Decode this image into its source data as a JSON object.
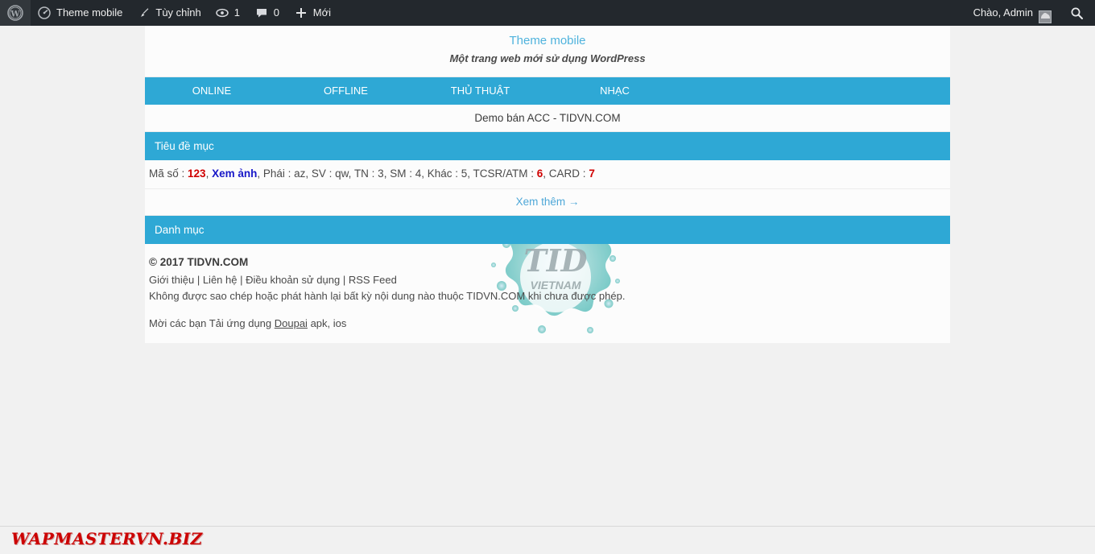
{
  "adminbar": {
    "wp_logo_icon": "wordpress-logo-icon",
    "site_icon": "dashboard-speedometer-icon",
    "site_name": "Theme mobile",
    "customize_icon": "paintbrush-icon",
    "customize_label": "Tùy chỉnh",
    "updates_icon": "updates-refresh-icon",
    "updates_count": "1",
    "comments_icon": "comment-bubble-icon",
    "comments_count": "0",
    "new_icon": "plus-icon",
    "new_label": "Mới",
    "howdy": "Chào, Admin",
    "avatar_icon": "user-avatar-icon",
    "search_icon": "search-icon"
  },
  "header": {
    "site_title": "Theme mobile",
    "tagline": "Một trang web mới sử dụng WordPress"
  },
  "nav": {
    "items": [
      {
        "label": "ONLINE"
      },
      {
        "label": "OFFLINE"
      },
      {
        "label": "THỦ THUẬT"
      },
      {
        "label": "NHẠC"
      }
    ]
  },
  "main": {
    "banner": "Demo bán ACC - TIDVN.COM",
    "section_title": "Tiêu đề mục",
    "item": {
      "label_ma_so": "Mã số :",
      "ma_so": "123",
      "sep1": ",",
      "xem_anh": "Xem ảnh",
      "rest": ", Phái : az, SV : qw, TN : 3, SM : 4, Khác : 5, TCSR/ATM :",
      "tcsr": "6",
      "card_label": ", CARD :",
      "card": "7"
    },
    "more_label": "Xem thêm →",
    "category_title": "Danh mục"
  },
  "footer": {
    "copyright": "© 2017 TIDVN.COM",
    "links": [
      {
        "label": "Giới thiệu"
      },
      {
        "label": "Liên hệ"
      },
      {
        "label": "Điều khoản sử dụng"
      },
      {
        "label": "RSS Feed"
      }
    ],
    "separator": " | ",
    "notice": "Không được sao chép hoặc phát hành lại bất kỳ nội dung nào thuộc TIDVN.COM khi chưa được phép.",
    "app_prefix": "Mời các bạn Tải ứng dụng ",
    "app_link": "Doupai",
    "app_suffix": " apk, ios",
    "watermark_icon": "tid-vietnam-watermark-logo",
    "watermark_main": "TID",
    "watermark_sub": "VIETNAM"
  },
  "brand": {
    "text": "WAPMASTERVN.BIZ"
  },
  "colors": {
    "accent_blue": "#2ea8d5",
    "title_blue": "#4fb3dd",
    "admin_dark": "#23282d",
    "page_bg": "#f1f1f1",
    "content_bg": "#fcfcfc",
    "red": "#d00000",
    "link_blue": "#1818c8",
    "brand_red": "#cc0000",
    "watermark_teal": "#6bc4c0"
  }
}
